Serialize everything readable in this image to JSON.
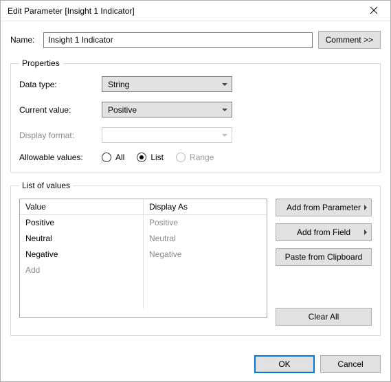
{
  "window": {
    "title": "Edit Parameter [Insight 1 Indicator]"
  },
  "name_row": {
    "label": "Name:",
    "value": "Insight 1 Indicator"
  },
  "comment_button": "Comment >>",
  "properties": {
    "legend": "Properties",
    "data_type": {
      "label": "Data type:",
      "value": "String"
    },
    "current_value": {
      "label": "Current value:",
      "value": "Positive"
    },
    "display_format": {
      "label": "Display format:",
      "value": ""
    },
    "allowable": {
      "label": "Allowable values:",
      "options": {
        "all": "All",
        "list": "List",
        "range": "Range"
      },
      "selected": "list"
    }
  },
  "list_of_values": {
    "legend": "List of values",
    "columns": {
      "value": "Value",
      "display_as": "Display As"
    },
    "rows": [
      {
        "value": "Positive",
        "display": "Positive"
      },
      {
        "value": "Neutral",
        "display": "Neutral"
      },
      {
        "value": "Negative",
        "display": "Negative"
      }
    ],
    "add_placeholder": "Add",
    "buttons": {
      "add_from_parameter": "Add from Parameter",
      "add_from_field": "Add from Field",
      "paste_clipboard": "Paste from Clipboard",
      "clear_all": "Clear All"
    }
  },
  "footer": {
    "ok": "OK",
    "cancel": "Cancel"
  }
}
